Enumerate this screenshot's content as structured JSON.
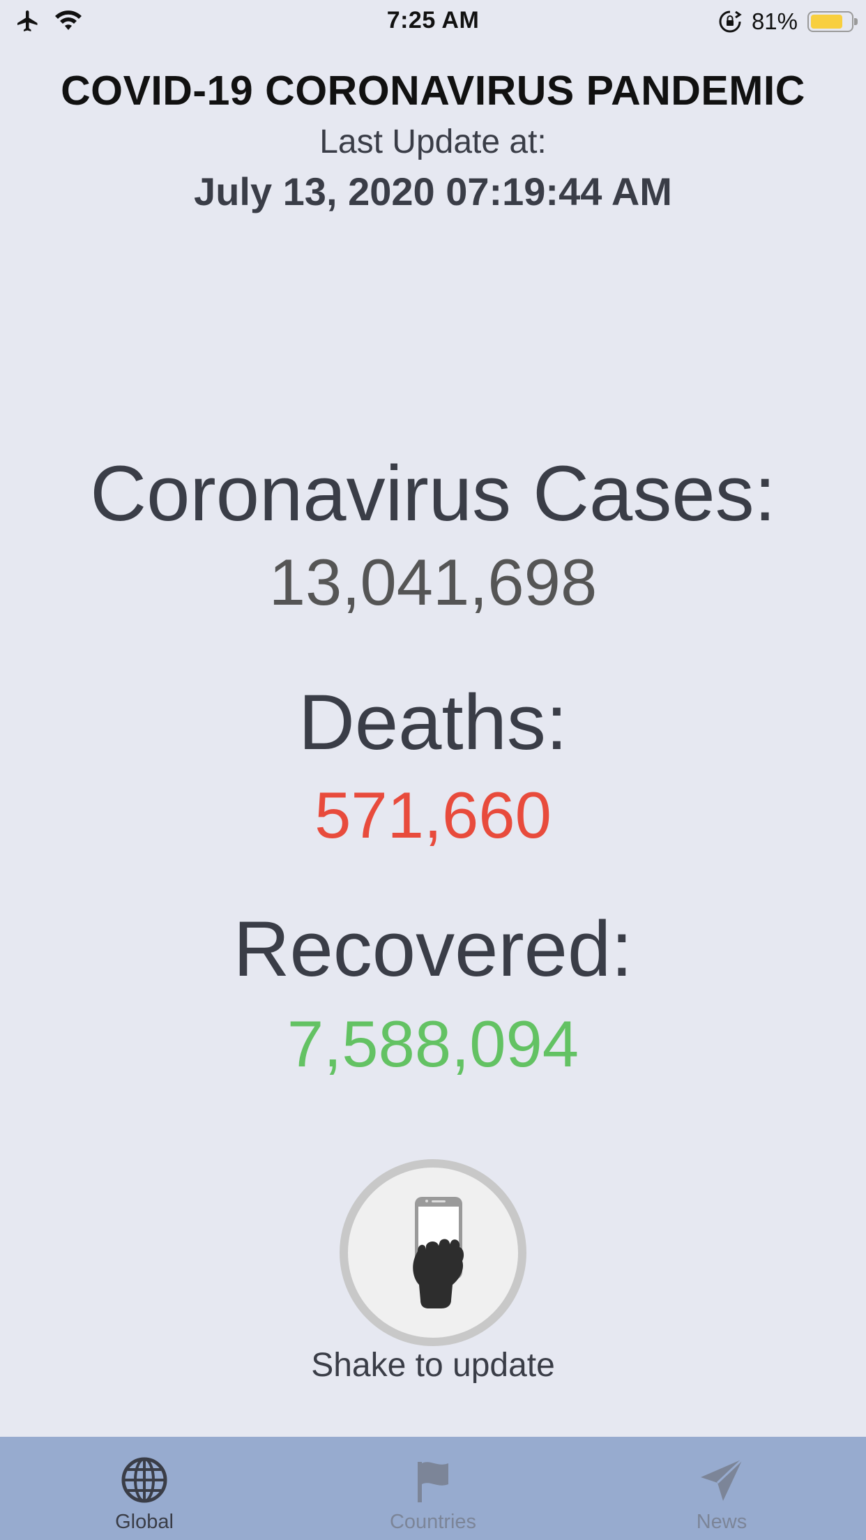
{
  "status_bar": {
    "time": "7:25 AM",
    "battery_percent": "81%",
    "battery_level": 0.81,
    "icons": [
      "airplane-icon",
      "wifi-icon",
      "rotation-lock-icon",
      "battery-icon"
    ]
  },
  "header": {
    "title": "COVID-19 CORONAVIRUS PANDEMIC",
    "last_update_label": "Last Update at:",
    "last_update_value": "July 13, 2020 07:19:44 AM"
  },
  "stats": {
    "cases_label": "Coronavirus Cases:",
    "cases_value": "13,041,698",
    "deaths_label": "Deaths:",
    "deaths_value": "571,660",
    "recovered_label": "Recovered:",
    "recovered_value": "7,588,094"
  },
  "shake": {
    "icon": "shake-phone-icon",
    "label": "Shake to update"
  },
  "tab_bar": {
    "tabs": [
      {
        "label": "Global",
        "icon": "globe-icon",
        "active": true
      },
      {
        "label": "Countries",
        "icon": "flag-icon",
        "active": false
      },
      {
        "label": "News",
        "icon": "paper-plane-icon",
        "active": false
      }
    ]
  },
  "colors": {
    "background": "#e6e8f1",
    "deaths": "#e84b3c",
    "recovered": "#63c263",
    "tab_bar": "#97abcf",
    "battery": "#f8cf3f"
  }
}
